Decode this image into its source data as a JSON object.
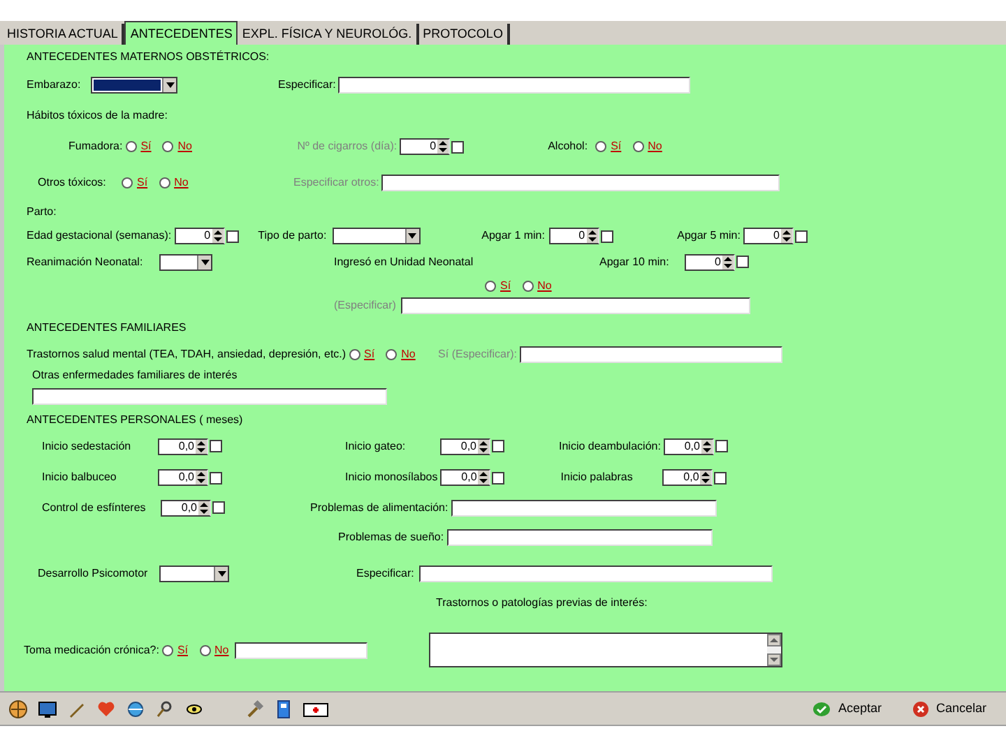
{
  "tabs": [
    {
      "label": "HISTORIA ACTUAL",
      "selected": false
    },
    {
      "label": "ANTECEDENTES",
      "selected": true
    },
    {
      "label": "EXPL. FÍSICA Y NEUROLÓG.",
      "selected": false
    },
    {
      "label": "PROTOCOLO",
      "selected": false
    }
  ],
  "form_rows": [
    [
      {
        "kind": "heading",
        "text": "ANTECEDENTES MATERNOS OBSTÉTRICOS:"
      }
    ],
    [
      {
        "kind": "label",
        "text": "Embarazo:",
        "disabled": false
      },
      {
        "kind": "select",
        "focused": true
      },
      {
        "kind": "label",
        "text": "Especificar:",
        "disabled": false
      },
      {
        "kind": "text"
      }
    ],
    [
      {
        "kind": "label",
        "text": "Hábitos tóxicos de la madre:",
        "disabled": false
      }
    ],
    [
      {
        "kind": "label",
        "text": "Fumadora:",
        "disabled": false
      },
      {
        "kind": "radios",
        "options": [
          {
            "label": "Sí",
            "selected": false
          },
          {
            "label": "No",
            "selected": false
          }
        ]
      },
      {
        "kind": "label",
        "text": "Nº de cigarros (día):",
        "disabled": true
      },
      {
        "kind": "spin",
        "value": "0",
        "checked": false
      },
      {
        "kind": "label",
        "text": "Alcohol:",
        "disabled": false
      },
      {
        "kind": "radios",
        "options": [
          {
            "label": "Sí",
            "selected": false
          },
          {
            "label": "No",
            "selected": false
          }
        ]
      }
    ],
    [
      {
        "kind": "label",
        "text": "Otros tóxicos:",
        "disabled": false
      },
      {
        "kind": "radios",
        "options": [
          {
            "label": "Sí",
            "selected": false
          },
          {
            "label": "No",
            "selected": false
          }
        ]
      },
      {
        "kind": "label",
        "text": "Especificar otros:",
        "disabled": true
      },
      {
        "kind": "text"
      }
    ],
    [
      {
        "kind": "label",
        "text": "Parto:",
        "disabled": false
      }
    ],
    [
      {
        "kind": "label",
        "text": "Edad gestacional (semanas):",
        "disabled": false
      },
      {
        "kind": "spin",
        "value": "0",
        "checked": false
      },
      {
        "kind": "label",
        "text": "Tipo de parto:",
        "disabled": false
      },
      {
        "kind": "select",
        "focused": false
      },
      {
        "kind": "label",
        "text": "Apgar 1 min:",
        "disabled": false
      },
      {
        "kind": "spin",
        "value": "0",
        "checked": false
      },
      {
        "kind": "label",
        "text": "Apgar 5 min:",
        "disabled": false
      },
      {
        "kind": "spin",
        "value": "0",
        "checked": false
      }
    ],
    [
      {
        "kind": "label",
        "text": "Reanimación Neonatal:",
        "disabled": false
      },
      {
        "kind": "select",
        "focused": false
      },
      {
        "kind": "label",
        "text": "Ingresó en Unidad Neonatal",
        "disabled": false
      },
      {
        "kind": "label",
        "text": "Apgar 10 min:",
        "disabled": false
      },
      {
        "kind": "spin",
        "value": "0",
        "checked": false
      }
    ],
    [
      {
        "kind": "radios",
        "options": [
          {
            "label": "Sí",
            "selected": false
          },
          {
            "label": "No",
            "selected": false
          }
        ]
      }
    ],
    [
      {
        "kind": "label",
        "text": "(Especificar)",
        "disabled": true
      },
      {
        "kind": "text"
      }
    ],
    [
      {
        "kind": "heading",
        "text": "ANTECEDENTES FAMILIARES"
      }
    ],
    [
      {
        "kind": "label",
        "text": "Trastornos salud mental (TEA, TDAH, ansiedad, depresión, etc.)",
        "disabled": false
      },
      {
        "kind": "radios",
        "options": [
          {
            "label": "Sí",
            "selected": false
          },
          {
            "label": "No",
            "selected": false
          }
        ]
      },
      {
        "kind": "label",
        "text": "Sí (Especificar):",
        "disabled": true
      },
      {
        "kind": "text"
      }
    ],
    [
      {
        "kind": "label",
        "text": "Otras enfermedades familiares de interés",
        "disabled": false
      }
    ],
    [
      {
        "kind": "text"
      }
    ],
    [
      {
        "kind": "heading",
        "text": "ANTECEDENTES PERSONALES ( meses)"
      }
    ],
    [
      {
        "kind": "label",
        "text": "Inicio sedestación",
        "disabled": false
      },
      {
        "kind": "spin",
        "value": "0,0",
        "checked": false
      },
      {
        "kind": "label",
        "text": "Inicio gateo:",
        "disabled": false
      },
      {
        "kind": "spin",
        "value": "0,0",
        "checked": false
      },
      {
        "kind": "label",
        "text": "Inicio deambulación:",
        "disabled": false
      },
      {
        "kind": "spin",
        "value": "0,0",
        "checked": false
      }
    ],
    [
      {
        "kind": "label",
        "text": "Inicio balbuceo",
        "disabled": false
      },
      {
        "kind": "spin",
        "value": "0,0",
        "checked": false
      },
      {
        "kind": "label",
        "text": "Inicio monosílabos",
        "disabled": false
      },
      {
        "kind": "spin",
        "value": "0,0",
        "checked": false
      },
      {
        "kind": "label",
        "text": "Inicio palabras",
        "disabled": false
      },
      {
        "kind": "spin",
        "value": "0,0",
        "checked": false
      }
    ],
    [
      {
        "kind": "label",
        "text": "Control de esfínteres",
        "disabled": false
      },
      {
        "kind": "spin",
        "value": "0,0",
        "checked": false
      },
      {
        "kind": "label",
        "text": "Problemas de alimentación:",
        "disabled": false
      },
      {
        "kind": "text"
      }
    ],
    [
      {
        "kind": "label",
        "text": "Problemas de sueño:",
        "disabled": false
      },
      {
        "kind": "text"
      }
    ],
    [
      {
        "kind": "label",
        "text": "Desarrollo Psicomotor",
        "disabled": false
      },
      {
        "kind": "select",
        "focused": false
      },
      {
        "kind": "label",
        "text": "Especificar:",
        "disabled": false
      },
      {
        "kind": "text"
      }
    ],
    [
      {
        "kind": "label",
        "text": "Trastornos o patologías previas de interés:",
        "disabled": false
      }
    ],
    [
      {
        "kind": "label",
        "text": "Toma medicación crónica?:",
        "disabled": false
      },
      {
        "kind": "radios",
        "options": [
          {
            "label": "Sí",
            "selected": false
          },
          {
            "label": "No",
            "selected": false
          }
        ]
      },
      {
        "kind": "text"
      },
      {
        "kind": "textarea"
      }
    ]
  ],
  "buttons": [
    {
      "label": "Aceptar",
      "kind": "ok"
    },
    {
      "label": "Cancelar",
      "kind": "cancel"
    }
  ]
}
